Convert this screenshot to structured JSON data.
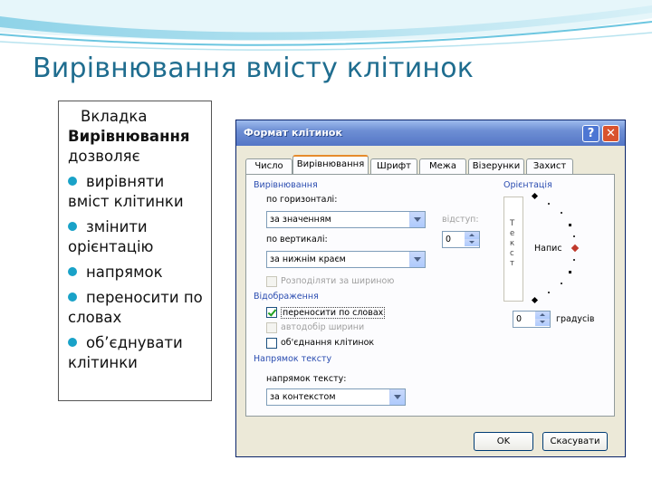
{
  "slide": {
    "title": "Вирівнювання вмісту клітинок"
  },
  "textbox": {
    "intro_plain": "Вкладка",
    "intro_bold": "Вирівнювання",
    "intro_rest": "дозволяє",
    "bullets": [
      "вирівняти вміст клітинки",
      "змінити орієнтацію",
      "напрямок",
      "переносити по словах",
      "об’єднувати клітинки"
    ]
  },
  "dialog": {
    "title": "Формат клітинок",
    "help_label": "?",
    "close_label": "✕",
    "tabs": [
      "Число",
      "Вирівнювання",
      "Шрифт",
      "Межа",
      "Візерунки",
      "Захист"
    ],
    "active_tab": "Вирівнювання",
    "alignment": {
      "group_label": "Вирівнювання",
      "horizontal_label": "по горизонталі:",
      "horizontal_value": "за значенням",
      "indent_label": "відступ:",
      "indent_value": "0",
      "vertical_label": "по вертикалі:",
      "vertical_value": "за нижнім краєм",
      "distribute_label": "Розподіляти за шириною"
    },
    "display": {
      "group_label": "Відображення",
      "wrap_label": "переносити по словах",
      "wrap_checked": true,
      "shrink_label": "автодобір ширини",
      "merge_label": "об'єднання клітинок"
    },
    "direction": {
      "group_label": "Напрямок тексту",
      "label": "напрямок тексту:",
      "value": "за контекстом"
    },
    "orientation": {
      "group_label": "Орієнтація",
      "vertical_text": "Текст",
      "sample_label": "Напис",
      "degrees_value": "0",
      "degrees_label": "градусів"
    },
    "ok_label": "OK",
    "cancel_label": "Скасувати"
  },
  "colors": {
    "title": "#1f6d8f",
    "bullet": "#19a2c8",
    "dialog_bg": "#ece9d8",
    "titlebar": "#6e8fd4"
  }
}
